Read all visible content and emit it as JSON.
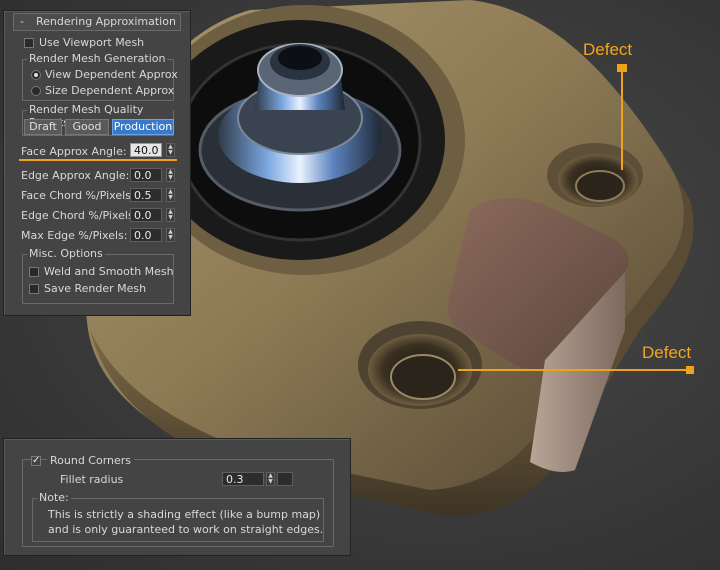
{
  "rollout": {
    "collapse_symbol": "-",
    "title": "Rendering Approximation",
    "use_viewport_mesh": "Use Viewport Mesh",
    "mesh_generation": {
      "title": "Render Mesh Generation",
      "view_dependent": "View Dependent Approx",
      "size_dependent": "Size Dependent Approx"
    },
    "presets": {
      "title": "Render Mesh Quality Presets",
      "draft": "Draft",
      "good": "Good",
      "production": "Production"
    },
    "params": [
      {
        "label": "Face Approx Angle:",
        "value": "40.0"
      },
      {
        "label": "Edge Approx Angle:",
        "value": "0.0"
      },
      {
        "label": "Face Chord %/Pixels:",
        "value": "0.5"
      },
      {
        "label": "Edge Chord %/Pixels:",
        "value": "0.0"
      },
      {
        "label": "Max Edge %/Pixels:",
        "value": "0.0"
      }
    ],
    "misc": {
      "title": "Misc. Options",
      "weld": "Weld and Smooth Mesh",
      "save": "Save Render Mesh"
    }
  },
  "corners": {
    "check_mark": "✓",
    "round_corners": "Round Corners",
    "fillet_label": "Fillet radius",
    "fillet_value": "0.3",
    "note_title": "Note:",
    "note_line1": "This is strictly a shading effect (like a bump map)",
    "note_line2": "and is only guaranteed to work on straight edges."
  },
  "annotations": {
    "defect_top": "Defect",
    "defect_bottom": "Defect"
  },
  "colors": {
    "accent_orange": "#f0a21a",
    "active_button": "#3a78c8",
    "panel_bg": "#444444",
    "brass": "#8d7a55"
  }
}
